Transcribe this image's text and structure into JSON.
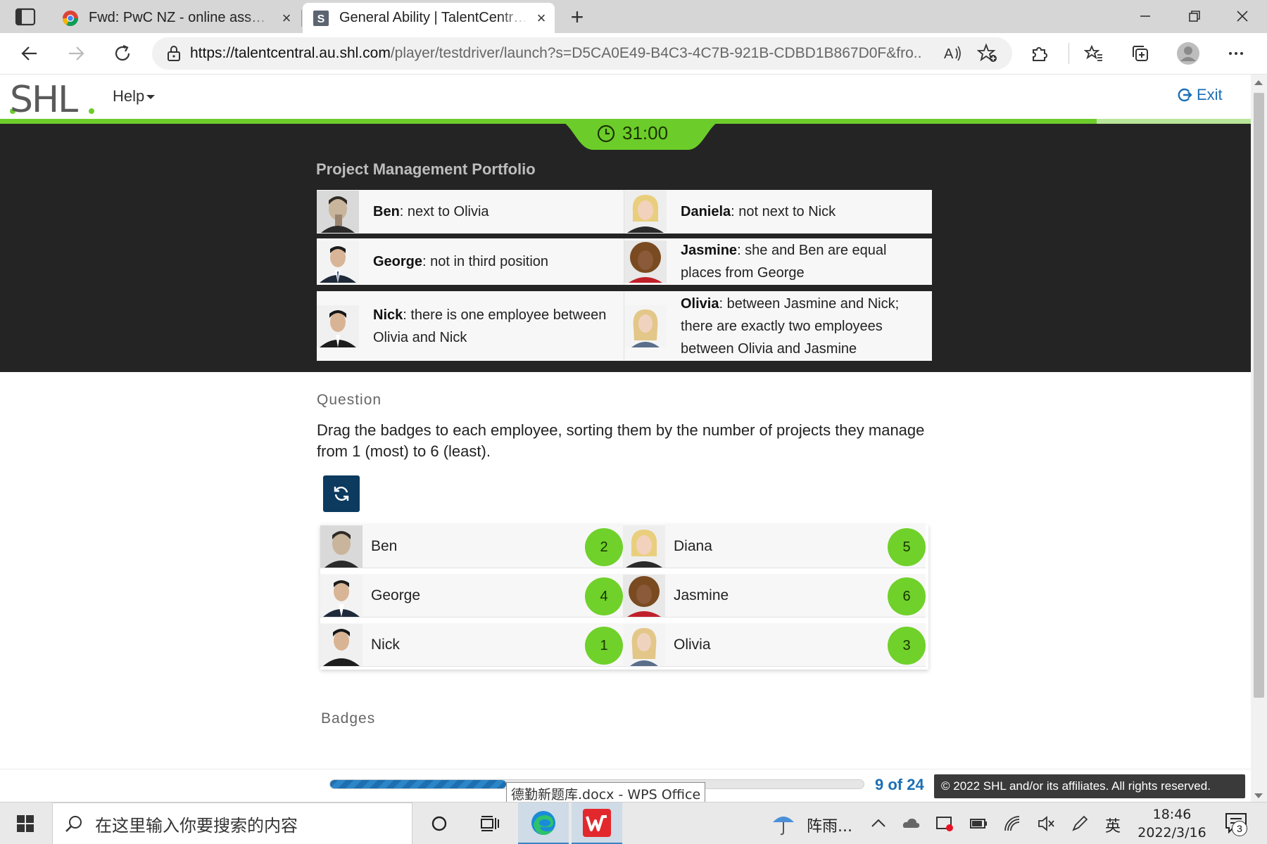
{
  "browser": {
    "tabs": [
      {
        "title": "Fwd: PwC NZ - online assessmen",
        "active": false
      },
      {
        "title": "General Ability | TalentCentral-Ca",
        "active": true
      }
    ],
    "close_glyph": "×",
    "new_tab_glyph": "+",
    "url_host": "https://talentcentral.au.shl.com",
    "url_rest": "/player/testdriver/launch?s=D5CA0E49-B4C3-4C7B-921B-CDBD1B867D0F&fro...",
    "window_controls": {
      "minimize": "—",
      "restore": "❐",
      "close": "✕"
    }
  },
  "app": {
    "logo": "SHL",
    "help_label": "Help",
    "exit_label": "Exit",
    "timer": "31:00",
    "progress_percent": 33,
    "progress_text": "9 of 24",
    "copyright": "© 2022 SHL and/or its affiliates. All rights reserved.",
    "tooltip": "德勤新题库.docx - WPS Office"
  },
  "portfolio": {
    "title": "Project Management Portfolio",
    "clues": [
      {
        "name": "Ben",
        "text": ": next to Olivia"
      },
      {
        "name": "Daniela",
        "text": ": not next to Nick"
      },
      {
        "name": "George",
        "text": ": not in third position"
      },
      {
        "name": "Jasmine",
        "text": ": she and Ben are equal places from George"
      },
      {
        "name": "Nick",
        "text": ": there is one employee between Olivia and Nick"
      },
      {
        "name": "Olivia",
        "text": ": between Jasmine and Nick; there are exactly two employees between Olivia and Jasmine"
      }
    ]
  },
  "question": {
    "label": "Question",
    "text": "Drag the badges to each employee, sorting them by the number of projects they manage from 1 (most) to 6 (least).",
    "employees": [
      {
        "name": "Ben",
        "badge": "2"
      },
      {
        "name": "Diana",
        "badge": "5"
      },
      {
        "name": "George",
        "badge": "4"
      },
      {
        "name": "Jasmine",
        "badge": "6"
      },
      {
        "name": "Nick",
        "badge": "1"
      },
      {
        "name": "Olivia",
        "badge": "3"
      }
    ],
    "badges_label": "Badges"
  },
  "taskbar": {
    "search_placeholder": "在这里输入你要搜索的内容",
    "weather": "阵雨...",
    "ime": "英",
    "time": "18:46",
    "date": "2022/3/16",
    "notification_count": "3"
  },
  "colors": {
    "brand_green": "#6ccd2a",
    "link_blue": "#1b6fb5",
    "dark_panel": "#242424",
    "reset_button": "#0d3a5f"
  }
}
